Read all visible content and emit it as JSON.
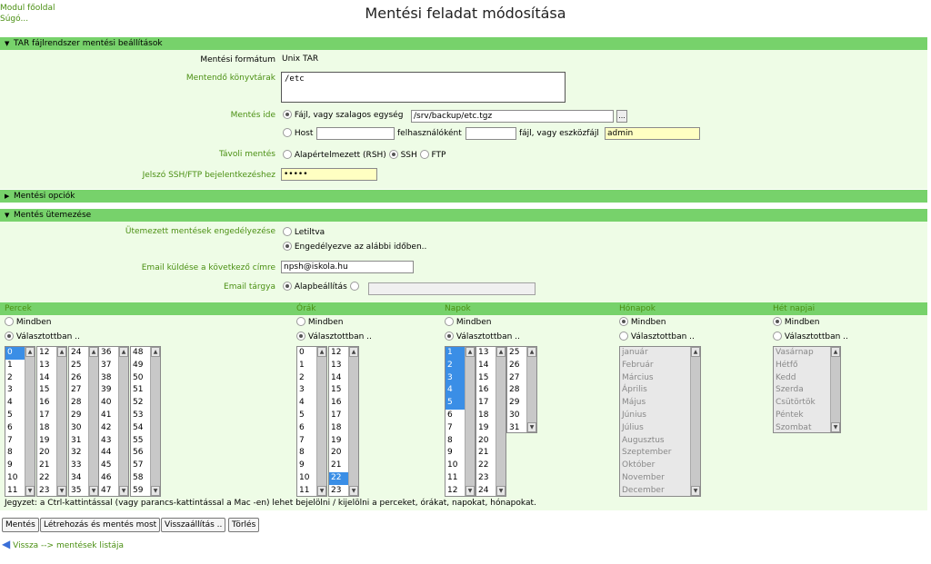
{
  "toplinks": {
    "module_index": "Modul főoldal",
    "help": "Súgó..."
  },
  "title": "Mentési feladat módosítása",
  "tar_section": {
    "header": "TAR fájlrendszer mentési beállítások",
    "format_label": "Mentési formátum",
    "format_value": "Unix TAR",
    "dirs_label": "Mentendő könyvtárak",
    "dirs_value": "/etc",
    "dest_label": "Mentés ide",
    "dest_file_label": "Fájl, vagy szalagos egység",
    "dest_file_value": "/srv/backup/etc.tgz",
    "browse_label": "...",
    "host_label": "Host",
    "as_user_label": "felhasználóként",
    "remote_file_label": "fájl, vagy eszközfájl",
    "remote_file_value": "admin",
    "remote_label": "Távoli mentés",
    "remote_rsh": "Alapértelmezett (RSH)",
    "remote_ssh": "SSH",
    "remote_ftp": "FTP",
    "password_label": "Jelszó SSH/FTP bejelentkezéshez",
    "password_value": "•••••"
  },
  "options_section": {
    "header": "Mentési opciók"
  },
  "schedule_section": {
    "header": "Mentés ütemezése",
    "enabled_label": "Ütemezett mentések engedélyezése",
    "disabled_opt": "Letiltva",
    "enabled_opt": "Engedélyezve az alábbi időben..",
    "email_label": "Email küldése a következő címre",
    "email_value": "npsh@iskola.hu",
    "subject_label": "Email tárgya",
    "subject_default": "Alapbeállítás"
  },
  "schedule": {
    "all_label": "Mindben",
    "selected_label": "Választottban ..",
    "minutes": {
      "header": "Percek",
      "col1": [
        "0",
        "1",
        "2",
        "3",
        "4",
        "5",
        "6",
        "7",
        "8",
        "9",
        "10",
        "11"
      ],
      "col2": [
        "12",
        "13",
        "14",
        "15",
        "16",
        "17",
        "18",
        "19",
        "20",
        "21",
        "22",
        "23"
      ],
      "col3": [
        "24",
        "25",
        "26",
        "27",
        "28",
        "29",
        "30",
        "31",
        "32",
        "33",
        "34",
        "35"
      ],
      "col4": [
        "36",
        "37",
        "38",
        "39",
        "40",
        "41",
        "42",
        "43",
        "44",
        "45",
        "46",
        "47"
      ],
      "col5": [
        "48",
        "49",
        "50",
        "51",
        "52",
        "53",
        "54",
        "55",
        "56",
        "57",
        "58",
        "59"
      ]
    },
    "hours": {
      "header": "Órák",
      "col1": [
        "0",
        "1",
        "2",
        "3",
        "4",
        "5",
        "6",
        "7",
        "8",
        "9",
        "10",
        "11"
      ],
      "col2": [
        "12",
        "13",
        "14",
        "15",
        "16",
        "17",
        "18",
        "19",
        "20",
        "21",
        "22",
        "23"
      ]
    },
    "days": {
      "header": "Napok",
      "col1": [
        "1",
        "2",
        "3",
        "4",
        "5",
        "6",
        "7",
        "8",
        "9",
        "10",
        "11",
        "12"
      ],
      "col2": [
        "13",
        "14",
        "15",
        "16",
        "17",
        "18",
        "19",
        "20",
        "21",
        "22",
        "23",
        "24"
      ],
      "col3": [
        "25",
        "26",
        "27",
        "28",
        "29",
        "30",
        "31"
      ]
    },
    "months": {
      "header": "Hónapok",
      "items": [
        "január",
        "Február",
        "Március",
        "Április",
        "Május",
        "Június",
        "Július",
        "Augusztus",
        "Szeptember",
        "Október",
        "November",
        "December"
      ]
    },
    "weekdays": {
      "header": "Hét napjai",
      "items": [
        "Vasárnap",
        "Hétfő",
        "Kedd",
        "Szerda",
        "Csütörtök",
        "Péntek",
        "Szombat"
      ]
    }
  },
  "note": "Jegyzet: a Ctrl-kattintással (vagy parancs-kattintással a Mac -en) lehet bejelölni / kijelölni a perceket, órákat, napokat, hónapokat.",
  "buttons": {
    "save": "Mentés",
    "create_run": "Létrehozás és mentés most",
    "restore": "Visszaállítás ..",
    "delete": "Törlés"
  },
  "back_link": "Vissza --> mentések listája"
}
